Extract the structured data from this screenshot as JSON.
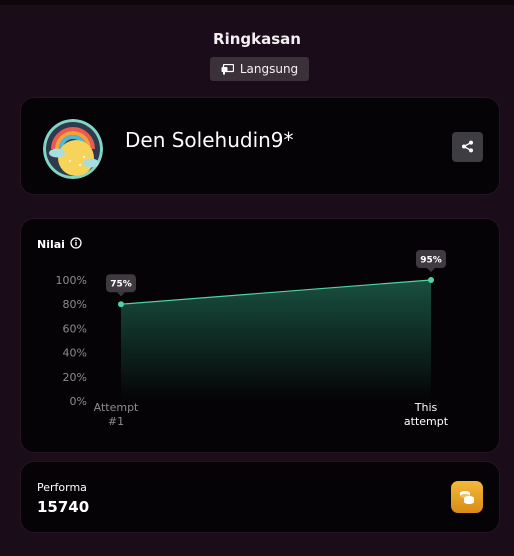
{
  "header": {
    "title": "Ringkasan",
    "mode_label": "Langsung",
    "mode_icon": "projector-icon"
  },
  "player": {
    "name": "Den Solehudin9*",
    "avatar": "rainbow-sun-avatar",
    "share_icon": "share-icon"
  },
  "score": {
    "label": "Nilai",
    "info_icon": "info-icon"
  },
  "chart_data": {
    "type": "area",
    "categories": [
      "Attempt #1",
      "This attempt"
    ],
    "category_lines": [
      [
        "Attempt",
        "#1"
      ],
      [
        "This",
        "attempt"
      ]
    ],
    "values": [
      80,
      100
    ],
    "data_labels": [
      "75%",
      "95%"
    ],
    "y_ticks": [
      "0%",
      "20%",
      "40%",
      "60%",
      "80%",
      "100%"
    ],
    "ylim": [
      0,
      100
    ],
    "grid": false,
    "line_color": "#4fd3a0",
    "fill_color": "#1f6a52"
  },
  "performance": {
    "label": "Performa",
    "value": "15740",
    "icon": "coins-icon",
    "icon_color": "#e9a42a"
  }
}
